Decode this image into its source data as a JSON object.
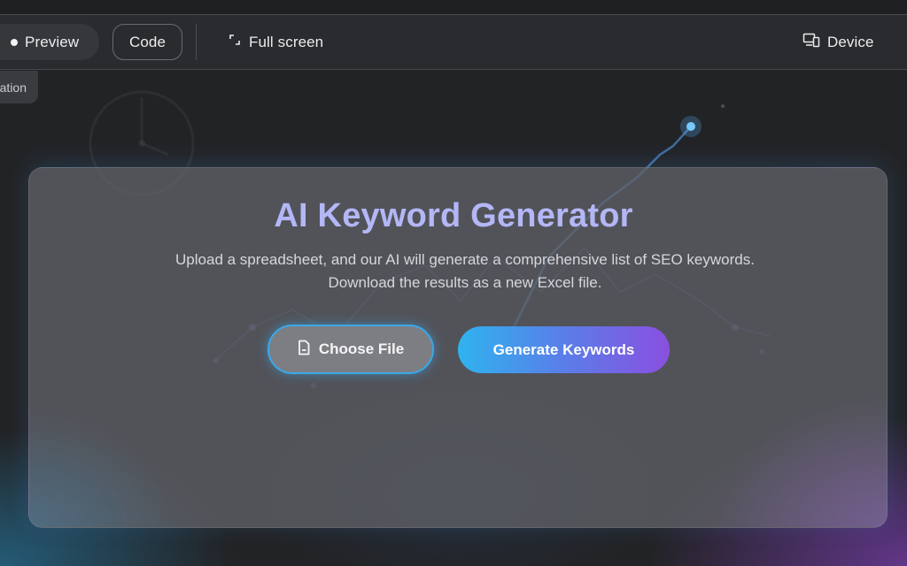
{
  "toolbar": {
    "preview_label": "Preview",
    "code_label": "Code",
    "fullscreen_label": "Full screen",
    "device_label": "Device"
  },
  "tooltip": {
    "partial_text": "ation"
  },
  "card": {
    "title": "AI Keyword Generator",
    "description": "Upload a spreadsheet, and our AI will generate a comprehensive list of SEO keywords. Download the results as a new Excel file.",
    "choose_file_label": "Choose File",
    "generate_label": "Generate Keywords"
  },
  "icons": {
    "fullscreen": "expand-icon",
    "device": "device-icon",
    "file": "file-icon",
    "preview_indicator": "dot-icon"
  },
  "colors": {
    "title": "#b3b7f6",
    "accent_start": "#2fb3ee",
    "accent_end": "#8a4fe0",
    "choose_border": "#3aa8e8"
  }
}
